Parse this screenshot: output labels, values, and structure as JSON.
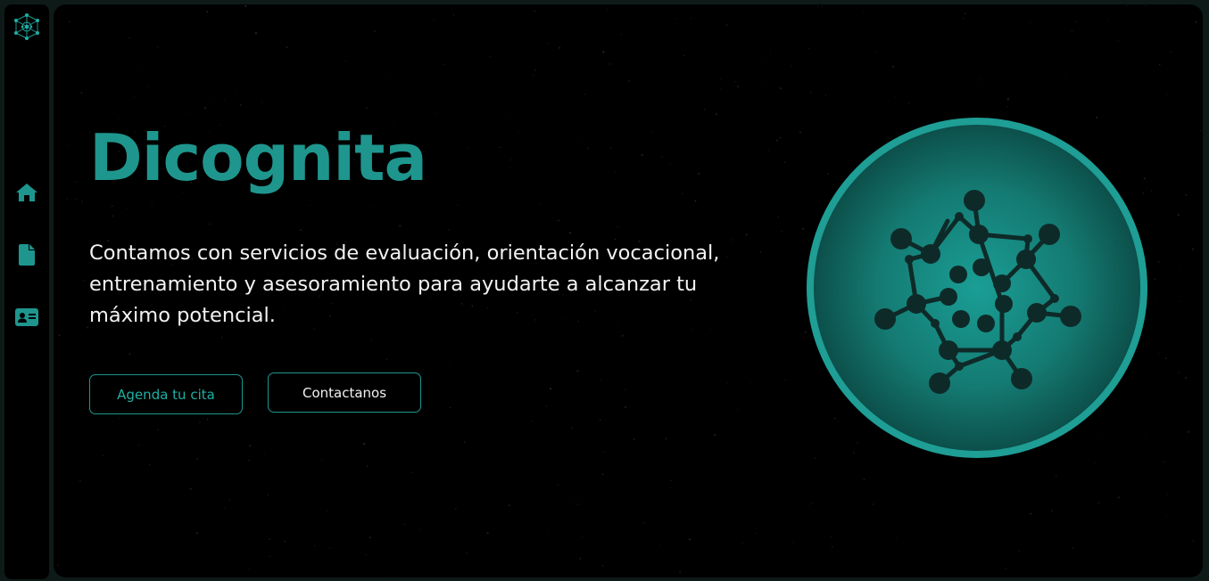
{
  "brand": {
    "logo_icon": "molecule-network-icon",
    "accent": "#1e968e"
  },
  "sidebar": {
    "items": [
      {
        "name": "home",
        "icon": "home-icon"
      },
      {
        "name": "document",
        "icon": "document-icon"
      },
      {
        "name": "contact-card",
        "icon": "id-card-icon"
      }
    ]
  },
  "hero": {
    "title": "Dicognita",
    "description": "Contamos con servicios de evaluación, orientación vocacional, entrenamiento y asesoramiento para ayudarte a alcanzar tu máximo potencial.",
    "primary_button": "Agenda tu cita",
    "secondary_button": "Contactanos",
    "illustration_icon": "molecule-network-icon"
  },
  "colors": {
    "background": "#000000",
    "frame": "#0d1a18",
    "accent": "#1e968e",
    "text": "#f2f2f2"
  }
}
